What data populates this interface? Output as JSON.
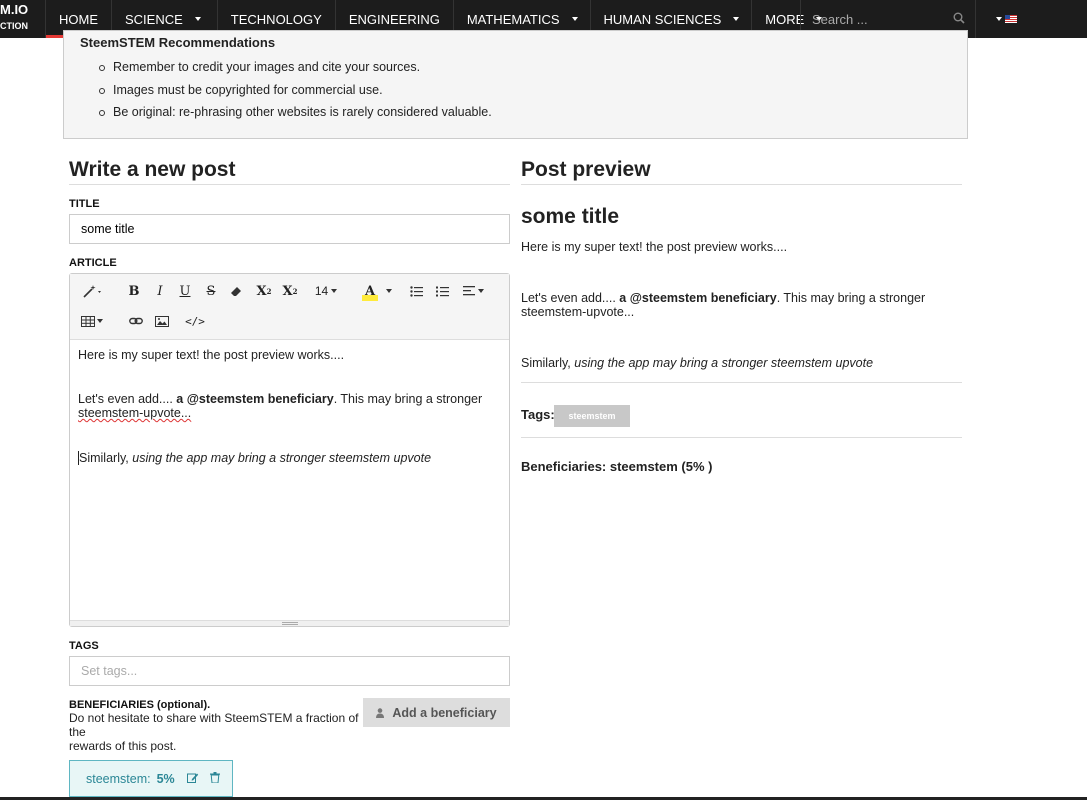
{
  "nav": {
    "brand_line1": "M.IO",
    "brand_line2": "CTION",
    "items": [
      {
        "label": "HOME",
        "color": "#e53935"
      },
      {
        "label": "SCIENCE",
        "color": "#1e88e5"
      },
      {
        "label": "TECHNOLOGY",
        "color": "#fb8c00"
      },
      {
        "label": "ENGINEERING",
        "color": "#fbc02d"
      },
      {
        "label": "MATHEMATICS",
        "color": "#e91e63"
      },
      {
        "label": "HUMAN SCIENCES",
        "color": "#00acc1"
      },
      {
        "label": "MORE",
        "color": "#7cb342"
      }
    ],
    "search_placeholder": "Search ...",
    "search_icon": "magnifier-icon",
    "language_icon": "us-flag-icon"
  },
  "recommendations": {
    "title": "SteemSTEM Recommendations",
    "items": [
      "Remember to credit your images and cite your sources.",
      "Images must be copyrighted for commercial use.",
      "Be original: re-phrasing other websites is rarely considered valuable."
    ]
  },
  "editor": {
    "heading": "Write a new post",
    "title_label": "TITLE",
    "title_value": "some title",
    "article_label": "ARTICLE",
    "font_size": "14",
    "body": {
      "line1": "Here is my super text! the post preview works....",
      "line2_pre": "Let's even add.... ",
      "line2_bold": "a @steemstem beneficiary",
      "line2_post": ". This may bring a stronger",
      "line3": "steemstem-upvote...",
      "line4_pre": "Similarly, ",
      "line4_italic": "using the app may bring a stronger steemstem upvote"
    },
    "tags_label": "TAGS",
    "tags_placeholder": "Set tags...",
    "beneficiaries_label": "BENEFICIARIES (optional).",
    "beneficiaries_help_1": "Do not hesitate to share with SteemSTEM a fraction of the",
    "beneficiaries_help_2": "rewards of this post.",
    "add_beneficiary_button": "Add a beneficiary",
    "beneficiary_name": "steemstem:",
    "beneficiary_percent": "5%"
  },
  "preview": {
    "heading": "Post preview",
    "title": "some title",
    "line1": "Here is my super text! the post preview works....",
    "line2_pre": "Let's even add.... ",
    "line2_bold": "a @steemstem beneficiary",
    "line2_post": ". This may bring a stronger",
    "line3": "steemstem-upvote...",
    "line4_pre": "Similarly, ",
    "line4_italic": "using the app may bring a stronger steemstem upvote",
    "tags_label": "Tags:",
    "tag": "steemstem",
    "beneficiaries_text": "Beneficiaries: steemstem (5% )"
  }
}
